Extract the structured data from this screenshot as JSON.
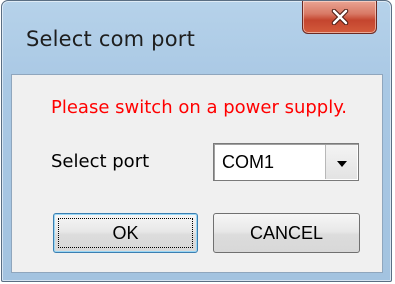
{
  "window": {
    "title": "Select com port",
    "close_icon": "close-x-icon"
  },
  "message": "Please switch on a power supply.",
  "port": {
    "label": "Select port",
    "selected": "COM1",
    "dropdown_icon": "chevron-down-icon"
  },
  "buttons": {
    "ok_label": "OK",
    "cancel_label": "CANCEL"
  },
  "colors": {
    "message": "#ff0000",
    "frame": "#a9c8e4",
    "close_button": "#c4452e",
    "client": "#f0f0f0"
  }
}
